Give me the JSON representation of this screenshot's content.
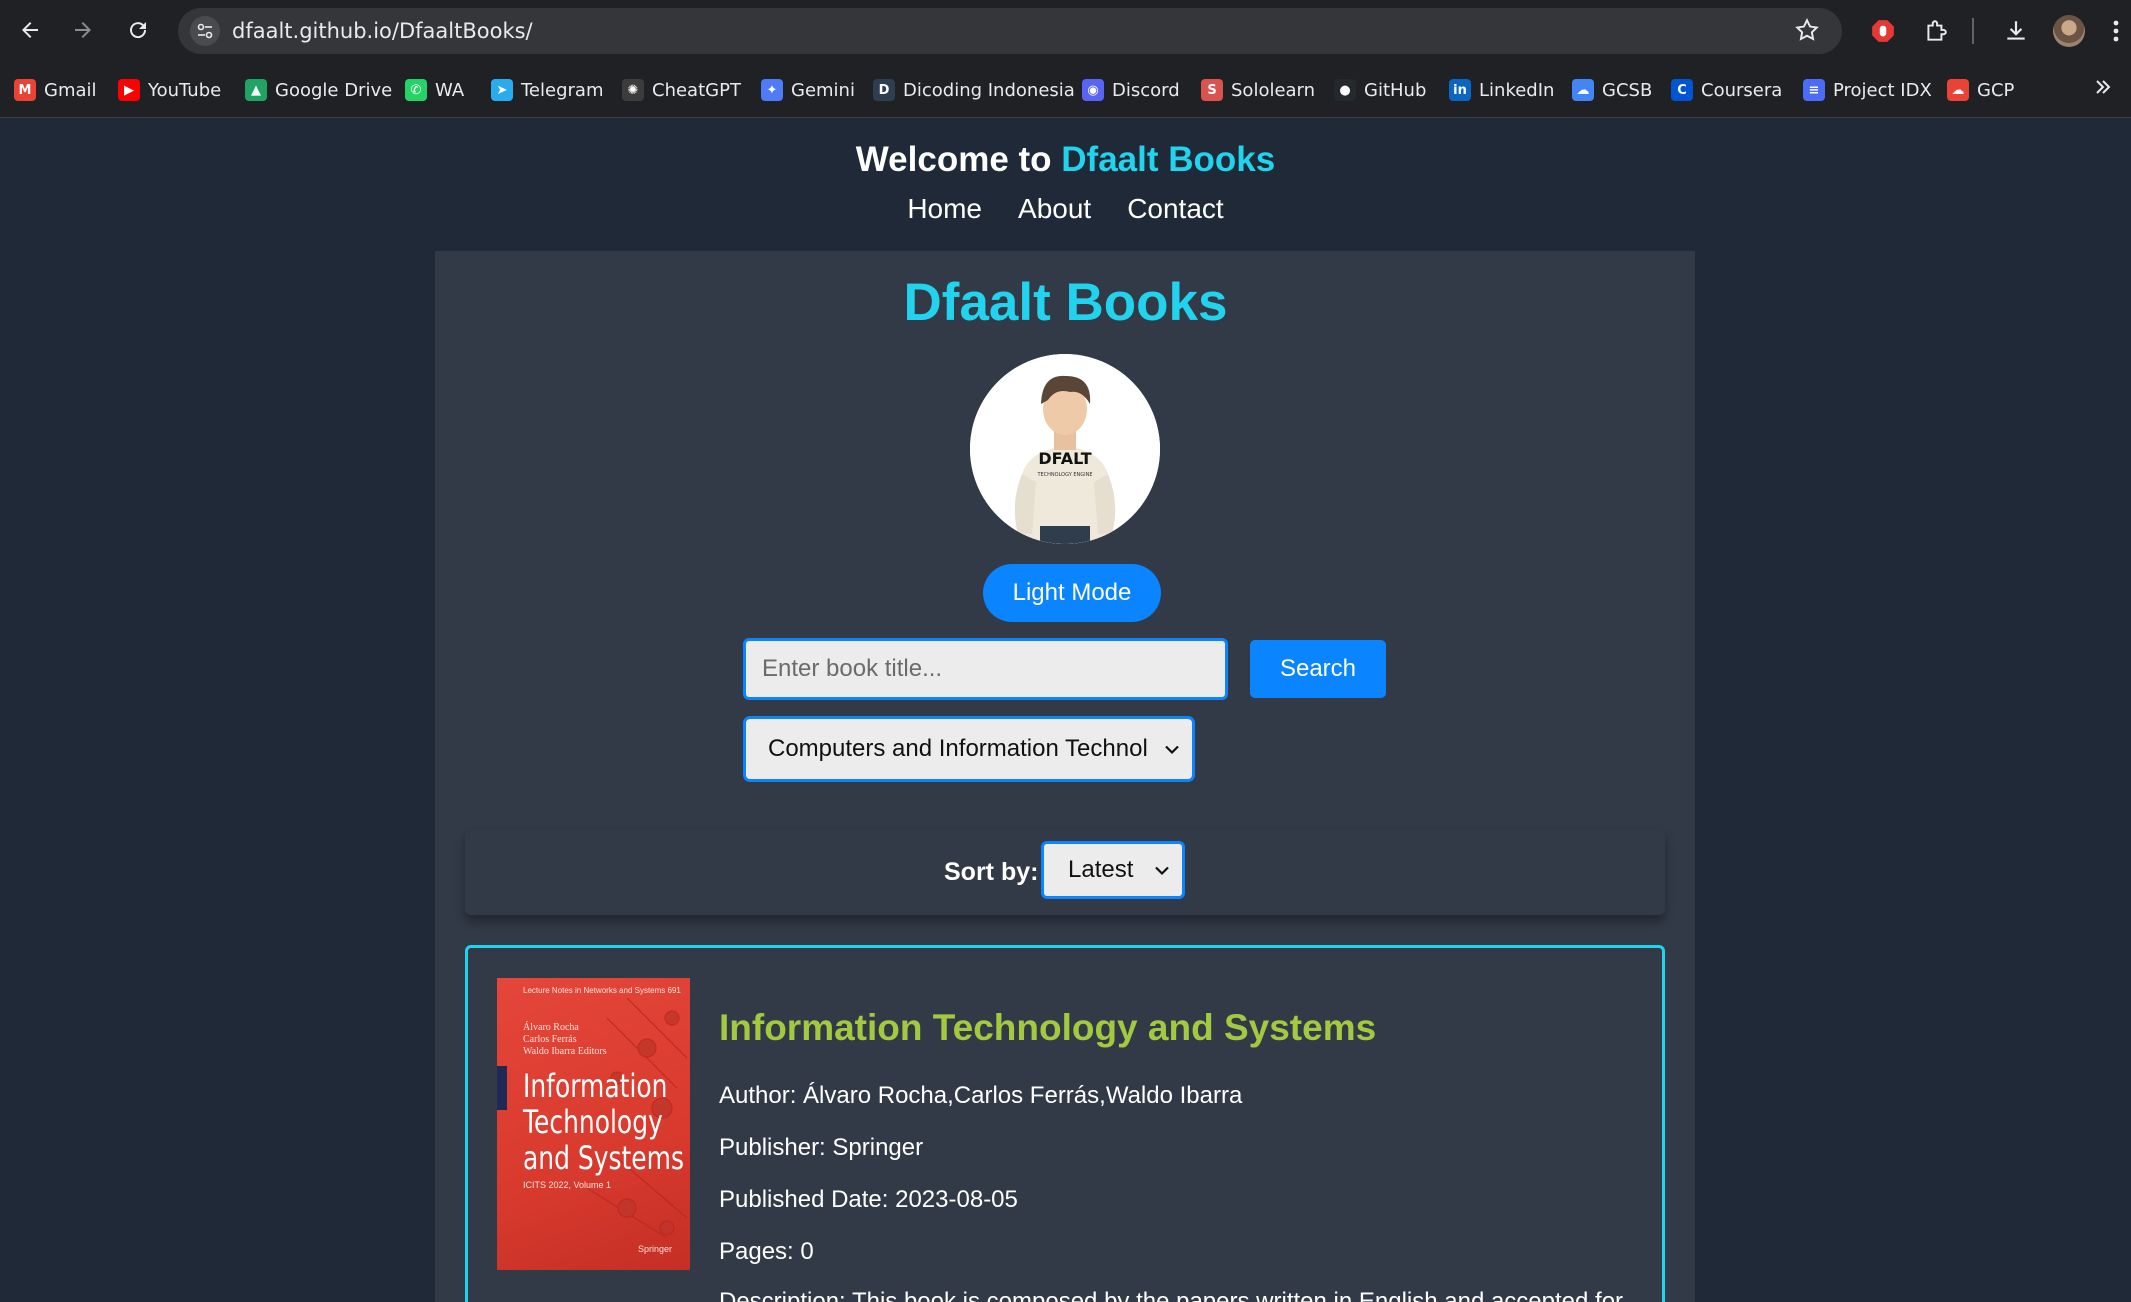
{
  "browser": {
    "url": "dfaalt.github.io/DfaaltBooks/",
    "bookmarks": [
      {
        "label": "Gmail",
        "icon": "gmail-icon",
        "color": "#ea4335",
        "glyph": "M"
      },
      {
        "label": "YouTube",
        "icon": "youtube-icon",
        "color": "#ff0000",
        "glyph": "▶"
      },
      {
        "label": "Google Drive",
        "icon": "google-drive-icon",
        "color": "#1fa463",
        "glyph": "▲"
      },
      {
        "label": "WA",
        "icon": "whatsapp-icon",
        "color": "#25d366",
        "glyph": "✆"
      },
      {
        "label": "Telegram",
        "icon": "telegram-icon",
        "color": "#2aabee",
        "glyph": "➤"
      },
      {
        "label": "CheatGPT",
        "icon": "chatgpt-icon",
        "color": "#3c3c3c",
        "glyph": "✺"
      },
      {
        "label": "Gemini",
        "icon": "gemini-icon",
        "color": "#4f7cf6",
        "glyph": "✦"
      },
      {
        "label": "Dicoding Indonesia",
        "icon": "dicoding-icon",
        "color": "#2d3e50",
        "glyph": "D"
      },
      {
        "label": "Discord",
        "icon": "discord-icon",
        "color": "#5865f2",
        "glyph": "◉"
      },
      {
        "label": "Sololearn",
        "icon": "sololearn-icon",
        "color": "#d9534f",
        "glyph": "S"
      },
      {
        "label": "GitHub",
        "icon": "github-icon",
        "color": "#24292e",
        "glyph": "●"
      },
      {
        "label": "LinkedIn",
        "icon": "linkedin-icon",
        "color": "#0a66c2",
        "glyph": "in"
      },
      {
        "label": "GCSB",
        "icon": "google-cloud-icon",
        "color": "#4285f4",
        "glyph": "☁"
      },
      {
        "label": "Coursera",
        "icon": "coursera-icon",
        "color": "#0056d2",
        "glyph": "C"
      },
      {
        "label": "Project IDX",
        "icon": "project-idx-icon",
        "color": "#4a6cf7",
        "glyph": "≡"
      },
      {
        "label": "GCP",
        "icon": "gcp-icon",
        "color": "#ea4335",
        "glyph": "☁"
      }
    ]
  },
  "header": {
    "welcome": "Welcome to",
    "brand": "Dfaalt Books",
    "nav": [
      "Home",
      "About",
      "Contact"
    ]
  },
  "main": {
    "title": "Dfaalt Books",
    "mode_button": "Light Mode",
    "search_placeholder": "Enter book title...",
    "search_button": "Search",
    "category": "Computers and Information Technology",
    "sort_label": "Sort by:",
    "sort_value": "Latest"
  },
  "book": {
    "title": "Information Technology and Systems",
    "author": "Author: Álvaro Rocha,Carlos Ferrás,Waldo Ibarra",
    "publisher": "Publisher: Springer",
    "published": "Published Date: 2023-08-05",
    "pages": "Pages: 0",
    "description": "Description: This book is composed by the papers written in English and accepted for",
    "cover": {
      "series": "Lecture Notes in Networks and Systems 691",
      "editors": [
        "Álvaro Rocha",
        "Carlos Ferrás",
        "Waldo Ibarra",
        "Editors"
      ],
      "title_lines": [
        "Information",
        "Technology",
        "and Systems"
      ],
      "subtitle": "ICITS 2022, Volume 1",
      "publisher": "Springer"
    }
  },
  "colors": {
    "accent": "#22d3ee",
    "button": "#0a84ff",
    "book_title": "#a3c940",
    "background": "#1f2937",
    "card": "#323a48"
  }
}
